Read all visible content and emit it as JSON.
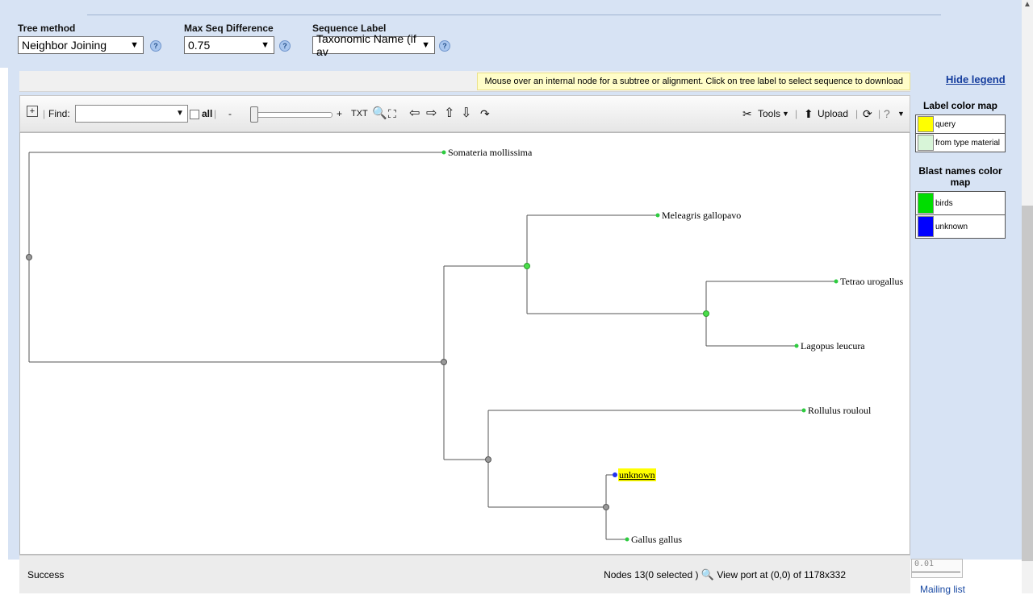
{
  "settings": {
    "tree_method": {
      "label": "Tree method",
      "value": "Neighbor Joining"
    },
    "max_seq_difference": {
      "label": "Max Seq Difference",
      "value": "0.75"
    },
    "sequence_label": {
      "label": "Sequence Label",
      "value": "Taxonomic Name (if av"
    }
  },
  "notice": "Mouse over an internal node for a subtree or alignment. Click on tree label to select sequence to download",
  "hide_legend": "Hide legend",
  "toolbar": {
    "find_label": "Find:",
    "all_label": "all",
    "zoom_minus": "-",
    "zoom_plus": "+",
    "txt_label": "TXT",
    "tools_label": "Tools",
    "upload_label": "Upload"
  },
  "tree": {
    "leaves": [
      {
        "label": "Somateria mollissima",
        "color": "#2ecc40"
      },
      {
        "label": "Meleagris gallopavo",
        "color": "#2ecc40"
      },
      {
        "label": "Tetrao urogallus",
        "color": "#2ecc40"
      },
      {
        "label": "Lagopus leucura",
        "color": "#2ecc40"
      },
      {
        "label": "Rollulus rouloul",
        "color": "#2ecc40"
      },
      {
        "label": "unknown",
        "color": "#2233ee",
        "highlight": "#ffff00"
      },
      {
        "label": "Gallus gallus",
        "color": "#2ecc40"
      }
    ]
  },
  "legend": {
    "label_map": {
      "title": "Label color map",
      "items": [
        {
          "label": "query",
          "color": "#ffff00"
        },
        {
          "label": "from type material",
          "color": "#d8f5d8"
        }
      ]
    },
    "blast_map": {
      "title": "Blast names color map",
      "items": [
        {
          "label": "birds",
          "color": "#00dd00"
        },
        {
          "label": "unknown",
          "color": "#0000ff"
        }
      ]
    }
  },
  "status": {
    "message": "Success",
    "nodes": "Nodes 13(0 selected )",
    "viewport": "View port at (0,0)  of 1178x332",
    "scale": "0.01"
  },
  "page_footer": "Mailing list"
}
